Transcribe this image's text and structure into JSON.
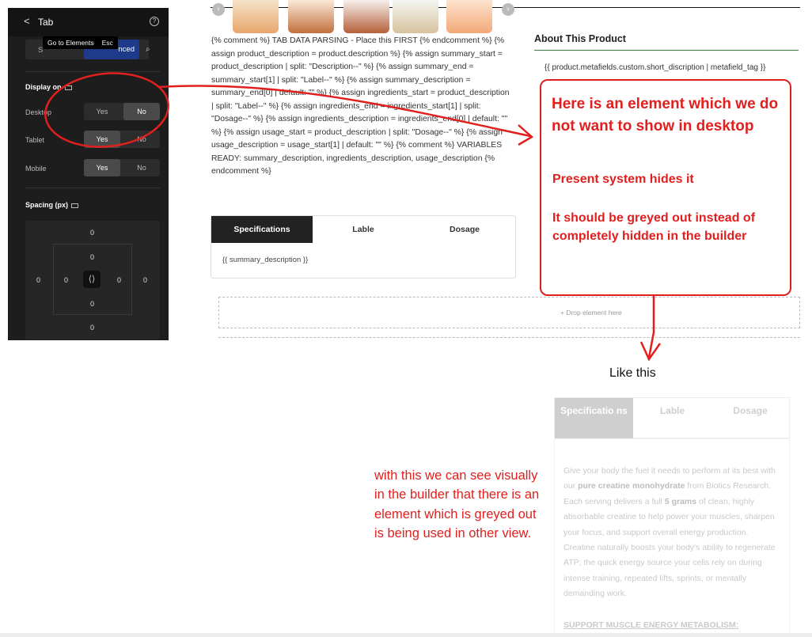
{
  "panel": {
    "back": "<",
    "title": "Tab",
    "help": "?",
    "tooltip": {
      "label": "Go to Elements",
      "key": "Esc"
    },
    "tabs": {
      "settings": "S",
      "advanced": "nced"
    },
    "display_on": "Display on",
    "rows": [
      {
        "label": "Desktop",
        "yes": "Yes",
        "no": "No",
        "active": "No"
      },
      {
        "label": "Tablet",
        "yes": "Yes",
        "no": "No",
        "active": "Yes"
      },
      {
        "label": "Mobile",
        "yes": "Yes",
        "no": "No",
        "active": "Yes"
      }
    ],
    "spacing_label": "Spacing (px)",
    "spacing": {
      "margin_top": "0",
      "margin_bottom": "0",
      "margin_left": "0",
      "margin_right": "0",
      "padding_top": "0",
      "padding_bottom": "0",
      "padding_left": "0",
      "padding_right": "0",
      "link": "⟨⟩"
    }
  },
  "code": "{% comment %} TAB DATA PARSING - Place this FIRST {% endcomment %} {% assign product_description = product.description %} {% assign summary_start = product_description | split: \"Description--\" %} {% assign summary_end = summary_start[1] | split: \"Label--\" %} {% assign summary_description = summary_end[0] | default: \"\" %} {% assign ingredients_start = product_description | split: \"Label--\" %} {% assign ingredients_end = ingredients_start[1] | split: \"Dosage--\" %} {% assign ingredients_description = ingredients_end[0] | default: \"\" %} {% assign usage_start = product_description | split: \"Dosage--\" %} {% assign usage_description = usage_start[1] | default: \"\" %} {% comment %} VARIABLES READY: summary_description, ingredients_description, usage_description {% endcomment %}",
  "spec_tabs": [
    "Specifications",
    "Lable",
    "Dosage"
  ],
  "spec_body": "{{ summary_description }}",
  "drop": "+  Drop element here",
  "about_title": "About This Product",
  "meta": "{{ product.metafields.custom.short_discription | metafield_tag }}",
  "annotation": {
    "heading": "Here is an element which we do not want to show in desktop",
    "sub1": "Present system hides it",
    "sub2": "It should be greyed out instead of completely hidden in the builder"
  },
  "like": "Like this",
  "grey": {
    "tabs": [
      "Specificatio ns",
      "Lable",
      "Dosage"
    ],
    "p1": "Give your body the fuel it needs to perform at its best with our ",
    "b1": "pure creatine monohydrate",
    "p2": " from Biotics Research. Each serving delivers a full ",
    "b2": "5 grams",
    "p3": " of clean, highly absorbable creatine to help power your muscles, sharpen your focus, and support overall energy production. Creatine naturally boosts your body's ability to regenerate ATP; the quick energy source your cells rely on during intense training, repeated lifts, sprints, or mentally demanding work.",
    "heading": "SUPPORT MUSCLE ENERGY METABOLISM:"
  },
  "note": "with this we can see visually in the builder that there is an element which is greyed out is being used in other view.",
  "colors": {
    "annotation_red": "#e0201e",
    "panel_bg": "#1d1d1d",
    "accent": "#1e3a8a"
  }
}
